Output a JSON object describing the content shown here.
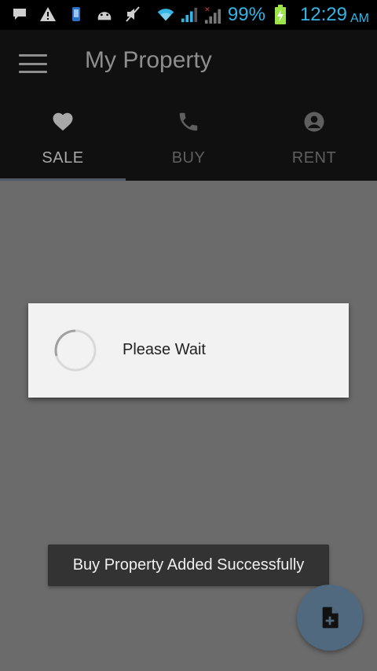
{
  "status_bar": {
    "battery_percent": "99%",
    "time": "12:29",
    "ampm": "AM",
    "icons": [
      "message-icon",
      "warning-icon",
      "phone-icon",
      "android-icon",
      "mute-icon",
      "wifi-icon",
      "signal-icon",
      "signal-noservice-icon",
      "battery-charging-icon"
    ]
  },
  "app_bar": {
    "title": "My Property"
  },
  "tabs": [
    {
      "label": "SALE",
      "icon": "heart-icon",
      "active": true
    },
    {
      "label": "BUY",
      "icon": "phone-icon",
      "active": false
    },
    {
      "label": "RENT",
      "icon": "person-icon",
      "active": false
    }
  ],
  "dialog": {
    "message": "Please Wait"
  },
  "toast": {
    "message": "Buy Property Added Successfully"
  },
  "fab": {
    "icon": "add-document-icon"
  },
  "colors": {
    "status_accent": "#33b5e5",
    "app_bar_bg": "#101010",
    "overlay_bg": "#6b6b6b",
    "fab_bg": "#51697f",
    "tab_indicator": "#4e5a66"
  }
}
